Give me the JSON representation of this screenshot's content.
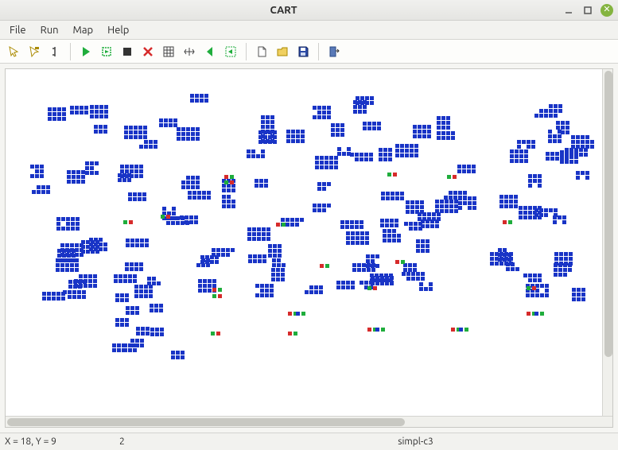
{
  "window": {
    "title": "CART"
  },
  "menu": {
    "file": "File",
    "run": "Run",
    "map": "Map",
    "help": "Help"
  },
  "toolbar": {
    "cursor_select": "cursor-select",
    "cursor_flag": "cursor-flag",
    "cursor_marker": "cursor-marker",
    "run_play": "run",
    "run_step": "step",
    "run_stop": "stop",
    "run_clear": "clear",
    "view_grid": "grid",
    "view_fit": "fit-width",
    "view_prev": "prev",
    "view_next": "next",
    "file_new": "new",
    "file_open": "open",
    "file_save": "save",
    "exit": "exit"
  },
  "status": {
    "coords": "X = 18, Y = 9",
    "value": "2",
    "mapname": "simpl-c3"
  },
  "colors": {
    "cell_blue": "#1934c6",
    "cell_red": "#d62b2b",
    "cell_green": "#1fad3c"
  }
}
